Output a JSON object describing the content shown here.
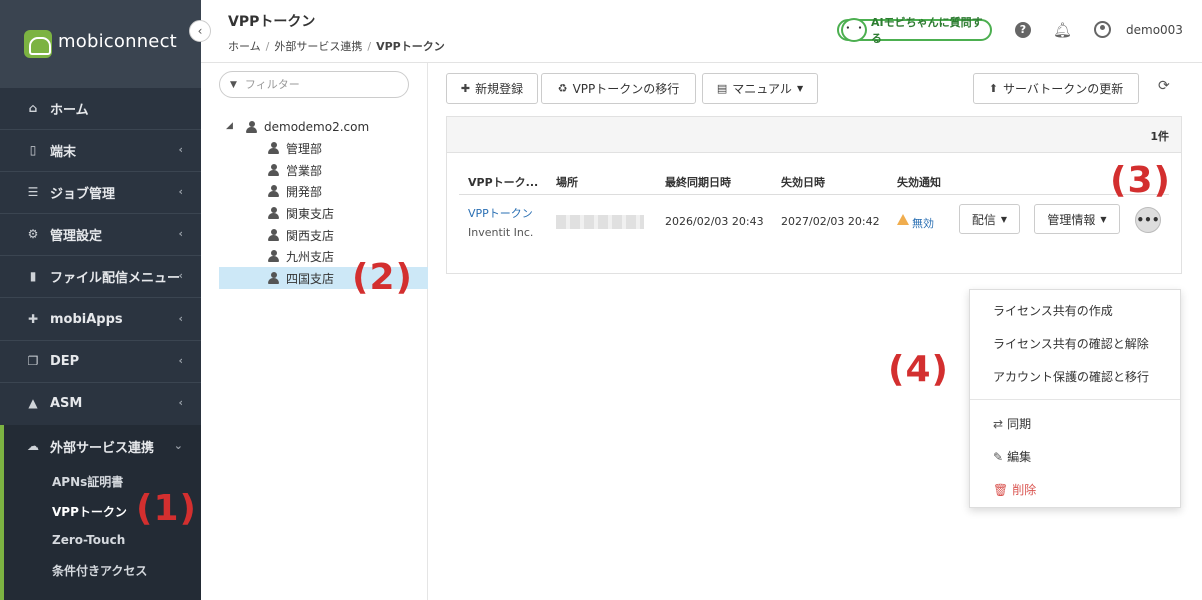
{
  "brand": {
    "name": "mobiconnect"
  },
  "sidebar": {
    "items": [
      {
        "label": "ホーム",
        "icon": "home-icon"
      },
      {
        "label": "端末",
        "icon": "device-icon"
      },
      {
        "label": "ジョブ管理",
        "icon": "job-icon"
      },
      {
        "label": "管理設定",
        "icon": "gears-icon"
      },
      {
        "label": "ファイル配信メニュー",
        "icon": "file-icon"
      },
      {
        "label": "mobiApps",
        "icon": "puzzle-icon"
      },
      {
        "label": "DEP",
        "icon": "copy-icon"
      },
      {
        "label": "ASM",
        "icon": "graduation-cap-icon"
      },
      {
        "label": "外部サービス連携",
        "icon": "cloud-icon"
      }
    ],
    "subitems": [
      {
        "label": "APNs証明書"
      },
      {
        "label": "VPPトークン"
      },
      {
        "label": "Zero-Touch"
      },
      {
        "label": "条件付きアクセス"
      }
    ]
  },
  "header": {
    "title": "VPPトークン",
    "breadcrumb": [
      "ホーム",
      "外部サービス連携",
      "VPPトークン"
    ],
    "ai_face": "・ ・",
    "ai_button": "AIモビちゃんに質問する",
    "user": "demo003"
  },
  "tree": {
    "filter_placeholder": "フィルター",
    "root": "demodemo2.com",
    "children": [
      "管理部",
      "営業部",
      "開発部",
      "関東支店",
      "関西支店",
      "九州支店",
      "四国支店"
    ]
  },
  "toolbar": {
    "new": "新規登録",
    "migrate": "VPPトークンの移行",
    "manual": "マニュアル",
    "server_token": "サーバトークンの更新"
  },
  "table": {
    "count": "1件",
    "headers": [
      "VPPトーク...",
      "場所",
      "最終同期日時",
      "失効日時",
      "失効通知"
    ],
    "row": {
      "name": "VPPトークン",
      "org": "Inventit Inc.",
      "last_sync": "2026/02/03 20:43",
      "expiry": "2027/02/03 20:42",
      "notice": "無効",
      "deliver_btn": "配信",
      "info_btn": "管理情報",
      "more_btn": "•••"
    }
  },
  "dropdown": {
    "items": [
      "ライセンス共有の作成",
      "ライセンス共有の確認と解除",
      "アカウント保護の確認と移行",
      "同期",
      "編集",
      "削除"
    ]
  },
  "annotations": [
    "(1)",
    "(2)",
    "(3)",
    "(4)"
  ],
  "colors": {
    "accent": "#7cb342",
    "sidebar": "#2b3440",
    "link": "#2a6fb3",
    "annotation": "#d32f2f",
    "danger": "#d9534f",
    "warning": "#f0ad4e"
  }
}
